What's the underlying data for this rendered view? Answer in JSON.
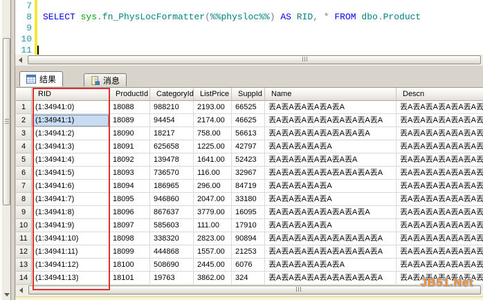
{
  "editor": {
    "line_numbers": [
      "7",
      "8",
      "9",
      "10",
      "11"
    ],
    "sql_tokens": [
      {
        "text": "SELECT ",
        "type": "keyword"
      },
      {
        "text": "sys",
        "type": "schema"
      },
      {
        "text": ".",
        "type": "operator"
      },
      {
        "text": "fn_PhysLocFormatter",
        "type": "function"
      },
      {
        "text": "(",
        "type": "operator"
      },
      {
        "text": "%%physloc%%",
        "type": "function"
      },
      {
        "text": ")",
        "type": "operator"
      },
      {
        "text": " ",
        "type": "plain"
      },
      {
        "text": "AS",
        "type": "keyword"
      },
      {
        "text": " ",
        "type": "plain"
      },
      {
        "text": "RID",
        "type": "function"
      },
      {
        "text": ", ",
        "type": "operator"
      },
      {
        "text": "* ",
        "type": "operator"
      },
      {
        "text": "FROM",
        "type": "keyword"
      },
      {
        "text": " ",
        "type": "plain"
      },
      {
        "text": "dbo",
        "type": "function"
      },
      {
        "text": ".",
        "type": "operator"
      },
      {
        "text": "Product",
        "type": "function"
      }
    ]
  },
  "tabs": {
    "results_label": "结果",
    "messages_label": "消息"
  },
  "grid": {
    "columns": [
      "RID",
      "ProductId",
      "CategoryId",
      "ListPrice",
      "SuppId",
      "Name",
      "Descn"
    ],
    "selected_cell": {
      "row": 2,
      "column": "RID"
    },
    "rows": [
      {
        "num": "1",
        "RID": "(1:34941:0)",
        "ProductId": "18088",
        "CategoryId": "988210",
        "ListPrice": "2193.00",
        "SuppId": "66525",
        "Name": "丟A丟A丟A丟A丟A丟A",
        "Descn": "丟A丟A丟A丟A丟A丟A丟A丟A丟A丟A"
      },
      {
        "num": "2",
        "RID": "(1:34941:1)",
        "ProductId": "18089",
        "CategoryId": "94454",
        "ListPrice": "2174.00",
        "SuppId": "46625",
        "Name": "丟A丟A丟A丟A丟A丟A丟A丟A丟A",
        "Descn": "丟A丟A丟A丟A丟A丟A丟A丟A丟A丟A"
      },
      {
        "num": "3",
        "RID": "(1:34941:2)",
        "ProductId": "18090",
        "CategoryId": "18217",
        "ListPrice": "758.00",
        "SuppId": "56613",
        "Name": "丟A丟A丟A丟A丟A丟A丟A丟A",
        "Descn": "丟A丟A丟A丟A丟A丟A丟A丟A丟A丟A"
      },
      {
        "num": "4",
        "RID": "(1:34941:3)",
        "ProductId": "18091",
        "CategoryId": "625658",
        "ListPrice": "1225.00",
        "SuppId": "42797",
        "Name": "丟A丟A丟A丟A丟A",
        "Descn": "丟A丟A丟A丟A丟A丟A丟A丟A丟A丟A"
      },
      {
        "num": "5",
        "RID": "(1:34941:4)",
        "ProductId": "18092",
        "CategoryId": "139478",
        "ListPrice": "1641.00",
        "SuppId": "52423",
        "Name": "丟A丟A丟A丟A丟A丟A丟A",
        "Descn": "丟A丟A丟A丟A丟A丟A丟A丟A丟A丟A"
      },
      {
        "num": "6",
        "RID": "(1:34941:5)",
        "ProductId": "18093",
        "CategoryId": "736570",
        "ListPrice": "116.00",
        "SuppId": "32967",
        "Name": "丟A丟A丟A丟A丟A丟A丟A丟A丟A",
        "Descn": "丟A丟A丟A丟A丟A丟A丟A丟A丟A丟A"
      },
      {
        "num": "7",
        "RID": "(1:34941:6)",
        "ProductId": "18094",
        "CategoryId": "186965",
        "ListPrice": "296.00",
        "SuppId": "84719",
        "Name": "丟A丟A丟A丟A丟A",
        "Descn": "丟A丟A丟A丟A丟A丟A丟A丟A丟A丟A"
      },
      {
        "num": "8",
        "RID": "(1:34941:7)",
        "ProductId": "18095",
        "CategoryId": "946860",
        "ListPrice": "2047.00",
        "SuppId": "33180",
        "Name": "丟A丟A丟A丟A丟A",
        "Descn": "丟A丟A丟A丟A丟A丟A丟A丟A丟A丟A"
      },
      {
        "num": "9",
        "RID": "(1:34941:8)",
        "ProductId": "18096",
        "CategoryId": "867637",
        "ListPrice": "3779.00",
        "SuppId": "16095",
        "Name": "丟A丟A丟A丟A丟A丟A丟A丟A",
        "Descn": "丟A丟A丟A丟A丟A丟A丟A丟A丟A丟A"
      },
      {
        "num": "10",
        "RID": "(1:34941:9)",
        "ProductId": "18097",
        "CategoryId": "585603",
        "ListPrice": "111.00",
        "SuppId": "17910",
        "Name": "丟A丟A丟A丟A丟A",
        "Descn": "丟A丟A丟A丟A丟A丟A丟A丟A丟A丟A"
      },
      {
        "num": "11",
        "RID": "(1:34941:10)",
        "ProductId": "18098",
        "CategoryId": "338320",
        "ListPrice": "2823.00",
        "SuppId": "90894",
        "Name": "丟A丟A丟A丟A丟A丟A丟A丟A丟A",
        "Descn": "丟A丟A丟A丟A丟A丟A丟A丟A丟A丟A"
      },
      {
        "num": "12",
        "RID": "(1:34941:11)",
        "ProductId": "18099",
        "CategoryId": "444868",
        "ListPrice": "1557.00",
        "SuppId": "21253",
        "Name": "丟A丟A丟A丟A丟A丟A丟A丟A丟A",
        "Descn": "丟A丟A丟A丟A丟A丟A丟A丟A丟A丟A"
      },
      {
        "num": "13",
        "RID": "(1:34941:12)",
        "ProductId": "18100",
        "CategoryId": "508690",
        "ListPrice": "2445.00",
        "SuppId": "6076",
        "Name": "丟A丟A丟A丟A丟A丟A",
        "Descn": "丟A丟A丟A丟A丟A丟A丟A丟A丟A丟A"
      },
      {
        "num": "14",
        "RID": "(1:34941:13)",
        "ProductId": "18101",
        "CategoryId": "19763",
        "ListPrice": "3862.00",
        "SuppId": "324",
        "Name": "丟A丟A丟A丟A丟A丟A丟A丟A丟A",
        "Descn": "丟A丟A丟A丟A丟A丟A丟A丟A丟A丟A"
      }
    ]
  },
  "watermark": "JB51.Net",
  "colors": {
    "keyword": "#0000EE",
    "schema": "#00A300",
    "identifier": "#00807E",
    "line_number": "#2B91AF",
    "change_bar": "#F2E637",
    "highlight_box": "#E03030",
    "selected_cell_bg": "#C7DCF3",
    "watermark": "#FF8A1E"
  }
}
